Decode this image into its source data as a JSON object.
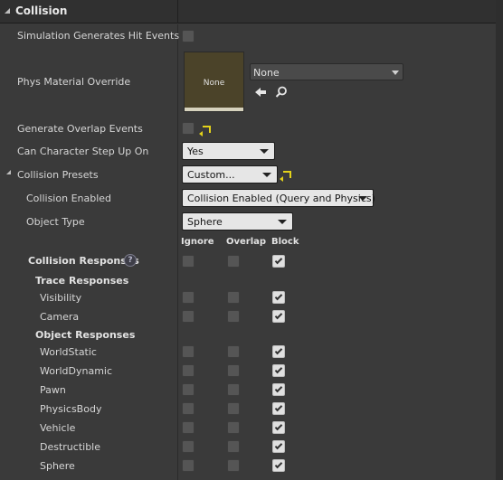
{
  "header": {
    "title": "Collision"
  },
  "rows": {
    "sim_hit_events": {
      "label": "Simulation Generates Hit Events",
      "checked": false
    },
    "phys_material": {
      "label": "Phys Material Override",
      "thumb_text": "None",
      "value": "None"
    },
    "overlap_events": {
      "label": "Generate Overlap Events",
      "checked": false
    },
    "step_up": {
      "label": "Can Character Step Up On",
      "value": "Yes"
    },
    "presets": {
      "label": "Collision Presets",
      "value": "Custom..."
    },
    "collision_enabled": {
      "label": "Collision Enabled",
      "value": "Collision Enabled (Query and Physics)"
    },
    "object_type": {
      "label": "Object Type",
      "value": "Sphere"
    }
  },
  "responses": {
    "columns": {
      "ignore": "Ignore",
      "overlap": "Overlap",
      "block": "Block"
    },
    "collision_label": "Collision Responses",
    "help_glyph": "?",
    "trace_label": "Trace Responses",
    "object_label": "Object Responses",
    "trace": [
      {
        "name": "Visibility",
        "ignore": false,
        "overlap": false,
        "block": true
      },
      {
        "name": "Camera",
        "ignore": false,
        "overlap": false,
        "block": true
      }
    ],
    "object": [
      {
        "name": "WorldStatic",
        "ignore": false,
        "overlap": false,
        "block": true
      },
      {
        "name": "WorldDynamic",
        "ignore": false,
        "overlap": false,
        "block": true
      },
      {
        "name": "Pawn",
        "ignore": false,
        "overlap": false,
        "block": true
      },
      {
        "name": "PhysicsBody",
        "ignore": false,
        "overlap": false,
        "block": true
      },
      {
        "name": "Vehicle",
        "ignore": false,
        "overlap": false,
        "block": true
      },
      {
        "name": "Destructible",
        "ignore": false,
        "overlap": false,
        "block": true
      },
      {
        "name": "Sphere",
        "ignore": false,
        "overlap": false,
        "block": true
      }
    ]
  },
  "colors": {
    "panel": "#3a3a3a",
    "header": "#303030",
    "reset_arrow": "#e3d21a",
    "material_swatch": "#4b4329"
  },
  "icons": {
    "header_toggle": "expanded-triangle-icon",
    "reset": "reset-to-default-icon",
    "use_selected": "left-arrow-icon",
    "browse": "search-icon",
    "help": "help-icon"
  }
}
